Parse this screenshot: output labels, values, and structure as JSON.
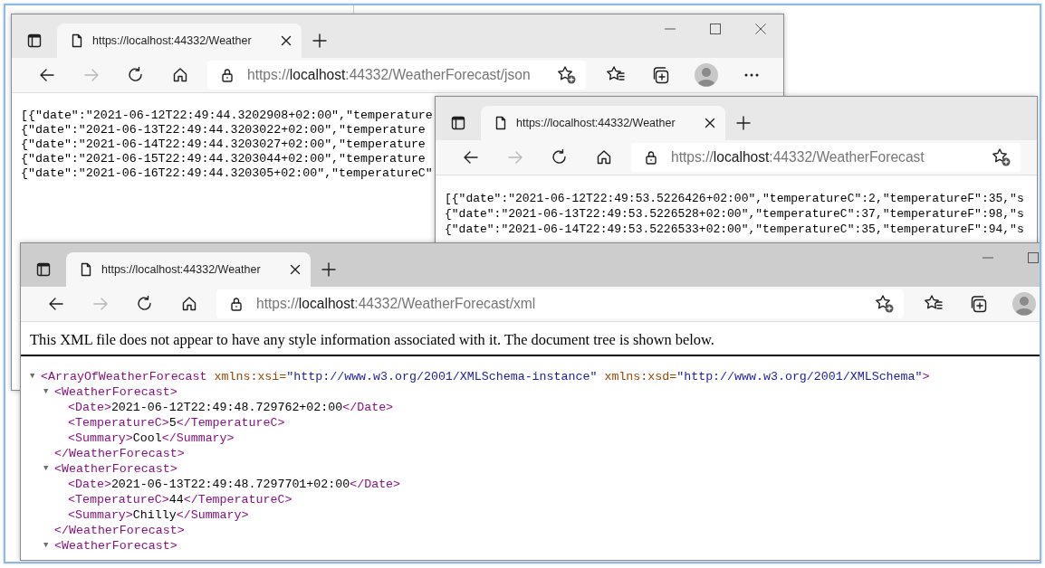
{
  "windows": [
    {
      "active": false,
      "window_controls": [
        {
          "kind": "minimize"
        },
        {
          "kind": "maximize"
        },
        {
          "kind": "close"
        }
      ],
      "tabs": [
        {
          "title": "https://localhost:44332/Weather",
          "selected": true
        }
      ],
      "forward_disabled": true,
      "address": {
        "scheme": "https://",
        "host": "localhost",
        "path": ":44332/WeatherForecast/json"
      },
      "toolbar": [
        {
          "kind": "favorites"
        },
        {
          "kind": "collections"
        },
        {
          "kind": "profile"
        },
        {
          "kind": "more"
        }
      ],
      "content": {
        "kind": "text",
        "lines": [
          "[{\"date\":\"2021-06-12T22:49:44.3202908+02:00\",\"temperature",
          "{\"date\":\"2021-06-13T22:49:44.3203022+02:00\",\"temperature",
          "{\"date\":\"2021-06-14T22:49:44.3203027+02:00\",\"temperature",
          "{\"date\":\"2021-06-15T22:49:44.3203044+02:00\",\"temperature",
          "{\"date\":\"2021-06-16T22:49:44.320305+02:00\",\"temperatureC\""
        ]
      }
    },
    {
      "active": false,
      "tabs": [
        {
          "title": "https://localhost:44332/Weather",
          "selected": true
        }
      ],
      "forward_disabled": true,
      "address": {
        "scheme": "https://",
        "host": "localhost",
        "path": ":44332/WeatherForecast"
      },
      "content": {
        "kind": "text",
        "lines": [
          "[{\"date\":\"2021-06-12T22:49:53.5226426+02:00\",\"temperatureC\":2,\"temperatureF\":35,\"s",
          "{\"date\":\"2021-06-13T22:49:53.5226528+02:00\",\"temperatureC\":37,\"temperatureF\":98,\"s",
          "{\"date\":\"2021-06-14T22:49:53.5226533+02:00\",\"temperatureC\":35,\"temperatureF\":94,\"s"
        ]
      }
    },
    {
      "active": true,
      "window_controls": [
        {
          "kind": "minimize"
        },
        {
          "kind": "maximize"
        }
      ],
      "tabs": [
        {
          "title": "https://localhost:44332/Weather",
          "selected": true
        }
      ],
      "forward_disabled": true,
      "address": {
        "scheme": "https://",
        "host": "localhost",
        "path": ":44332/WeatherForecast/xml"
      },
      "toolbar": [
        {
          "kind": "favorites"
        },
        {
          "kind": "collections"
        },
        {
          "kind": "profile"
        }
      ],
      "content": {
        "kind": "xml",
        "notice": "This XML file does not appear to have any style information associated with it. The document tree is shown below.",
        "tree": [
          {
            "toggle": "▼",
            "expanded": true,
            "open": "<ArrayOfWeatherForecast",
            "attributes": [
              {
                "name": "xmlns:xsi=",
                "value": "\"http://www.w3.org/2001/XMLSchema-instance\""
              },
              {
                "name": "xmlns:xsd=",
                "value": "\"http://www.w3.org/2001/XMLSchema\""
              }
            ],
            "open_end": ">",
            "children": [
              {
                "toggle": "▼",
                "expanded": true,
                "open": "<WeatherForecast>",
                "children": [
                  {
                    "open": "<Date>",
                    "text": "2021-06-12T22:49:48.729762+02:00",
                    "close": "</Date>"
                  },
                  {
                    "open": "<TemperatureC>",
                    "text": "5",
                    "close": "</TemperatureC>"
                  },
                  {
                    "open": "<Summary>",
                    "text": "Cool",
                    "close": "</Summary>"
                  }
                ],
                "close": "</WeatherForecast>"
              },
              {
                "toggle": "▼",
                "expanded": true,
                "open": "<WeatherForecast>",
                "children": [
                  {
                    "open": "<Date>",
                    "text": "2021-06-13T22:49:48.7297701+02:00",
                    "close": "</Date>"
                  },
                  {
                    "open": "<TemperatureC>",
                    "text": "44",
                    "close": "</TemperatureC>"
                  },
                  {
                    "open": "<Summary>",
                    "text": "Chilly",
                    "close": "</Summary>"
                  }
                ],
                "close": "</WeatherForecast>"
              },
              {
                "toggle": "▼",
                "expanded": true,
                "open": "<WeatherForecast>"
              }
            ]
          }
        ]
      }
    }
  ]
}
